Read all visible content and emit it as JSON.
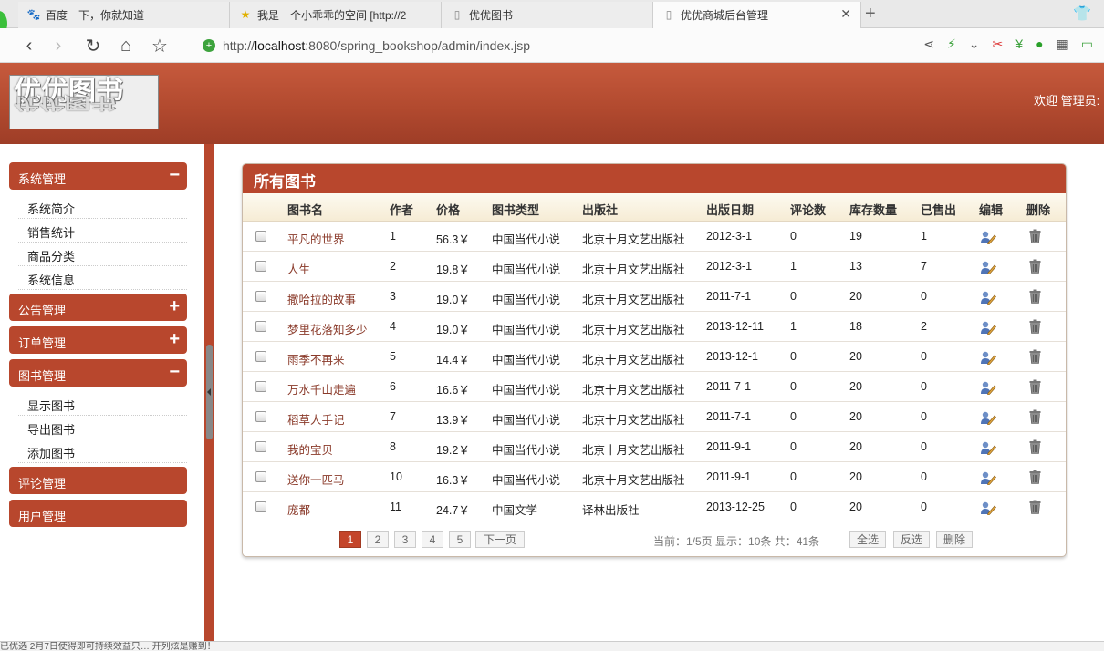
{
  "browser": {
    "tabs": [
      {
        "label": "百度一下，你就知道",
        "icon": "paw-icon"
      },
      {
        "label": "我是一个小乖乖的空间 [http://2",
        "icon": "star-icon"
      },
      {
        "label": "优优图书",
        "icon": "page-icon"
      },
      {
        "label": "优优商城后台管理",
        "icon": "page-icon",
        "active": true
      }
    ],
    "url_prefix": "http://",
    "url_host": "localhost",
    "url_rest": ":8080/spring_bookshop/admin/index.jsp"
  },
  "header": {
    "logo_text": "优优图书",
    "welcome": "欢迎  管理员:"
  },
  "sidebar": {
    "groups": [
      {
        "label": "系统管理",
        "sign": "−",
        "items": [
          "系统简介",
          "销售统计",
          "商品分类",
          "系统信息"
        ]
      },
      {
        "label": "公告管理",
        "sign": "+",
        "items": []
      },
      {
        "label": "订单管理",
        "sign": "+",
        "items": []
      },
      {
        "label": "图书管理",
        "sign": "−",
        "items": [
          "显示图书",
          "导出图书",
          "添加图书"
        ]
      },
      {
        "label": "评论管理",
        "sign": "",
        "items": []
      },
      {
        "label": "用户管理",
        "sign": "",
        "items": []
      }
    ]
  },
  "panel": {
    "title": "所有图书",
    "columns": [
      "图书名",
      "作者",
      "价格",
      "图书类型",
      "出版社",
      "出版日期",
      "评论数",
      "库存数量",
      "已售出",
      "编辑",
      "删除"
    ],
    "rows": [
      [
        "平凡的世界",
        "1",
        "56.3￥",
        "中国当代小说",
        "北京十月文艺出版社",
        "2012-3-1",
        "0",
        "19",
        "1"
      ],
      [
        "人生",
        "2",
        "19.8￥",
        "中国当代小说",
        "北京十月文艺出版社",
        "2012-3-1",
        "1",
        "13",
        "7"
      ],
      [
        "撒哈拉的故事",
        "3",
        "19.0￥",
        "中国当代小说",
        "北京十月文艺出版社",
        "2011-7-1",
        "0",
        "20",
        "0"
      ],
      [
        "梦里花落知多少",
        "4",
        "19.0￥",
        "中国当代小说",
        "北京十月文艺出版社",
        "2013-12-11",
        "1",
        "18",
        "2"
      ],
      [
        "雨季不再来",
        "5",
        "14.4￥",
        "中国当代小说",
        "北京十月文艺出版社",
        "2013-12-1",
        "0",
        "20",
        "0"
      ],
      [
        "万水千山走遍",
        "6",
        "16.6￥",
        "中国当代小说",
        "北京十月文艺出版社",
        "2011-7-1",
        "0",
        "20",
        "0"
      ],
      [
        "稻草人手记",
        "7",
        "13.9￥",
        "中国当代小说",
        "北京十月文艺出版社",
        "2011-7-1",
        "0",
        "20",
        "0"
      ],
      [
        "我的宝贝",
        "8",
        "19.2￥",
        "中国当代小说",
        "北京十月文艺出版社",
        "2011-9-1",
        "0",
        "20",
        "0"
      ],
      [
        "送你一匹马",
        "10",
        "16.3￥",
        "中国当代小说",
        "北京十月文艺出版社",
        "2011-9-1",
        "0",
        "20",
        "0"
      ],
      [
        "庞都",
        "11",
        "24.7￥",
        "中国文学",
        "译林出版社",
        "2013-12-25",
        "0",
        "20",
        "0"
      ]
    ],
    "pager": {
      "pages": [
        "1",
        "2",
        "3",
        "4",
        "5"
      ],
      "next": "下一页",
      "info": "当前：1/5页  显示：10条  共：41条",
      "select_all": "全选",
      "invert": "反选",
      "delete": "删除"
    }
  },
  "statusbar": {
    "text": "已优选      2月7日使得即可持续效益只…  开列炫是赚到！"
  },
  "colors": {
    "accent": "#b8472d",
    "header_dark": "#9e3d27",
    "name_link": "#8a3a2a"
  }
}
